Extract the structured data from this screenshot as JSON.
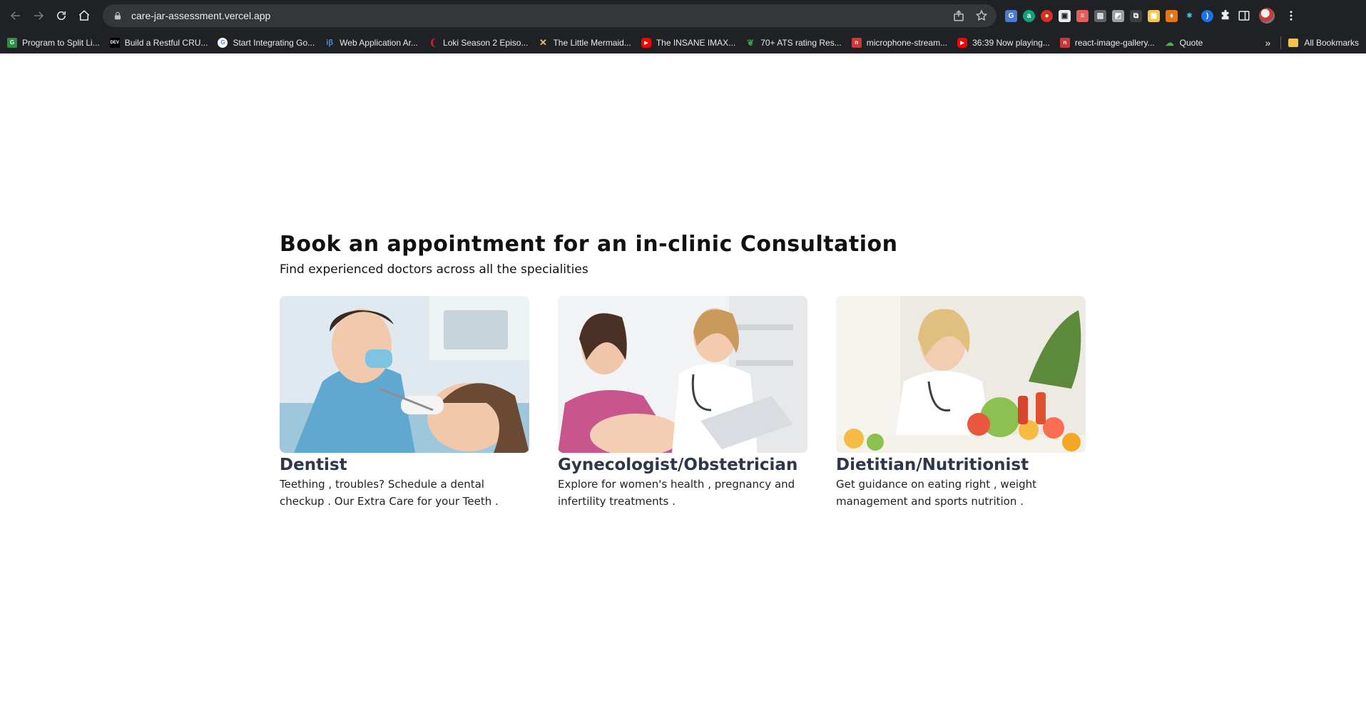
{
  "browser": {
    "url": "care-jar-assessment.vercel.app",
    "bookmarks": [
      {
        "label": "Program to Split Li...",
        "icon": "gfg-icon",
        "color": "#2f8d46"
      },
      {
        "label": "Build a Restful CRU...",
        "icon": "dev-icon",
        "color": "#000000"
      },
      {
        "label": "Start Integrating Go...",
        "icon": "google-icon",
        "color": "#ffffff"
      },
      {
        "label": "Web Application Ar...",
        "icon": "beta-icon",
        "color": "#4a90d9"
      },
      {
        "label": "Loki Season 2 Episo...",
        "icon": "loki-icon",
        "color": "#c62828"
      },
      {
        "label": "The Little Mermaid...",
        "icon": "x-star-icon",
        "color": "#e8c07a"
      },
      {
        "label": "The INSANE IMAX...",
        "icon": "youtube-icon",
        "color": "#ff0000"
      },
      {
        "label": "70+ ATS rating Res...",
        "icon": "leaf-icon",
        "color": "#3fa34d"
      },
      {
        "label": "microphone-stream...",
        "icon": "npm-icon",
        "color": "#cb3837"
      },
      {
        "label": "36:39 Now playing...",
        "icon": "youtube-icon",
        "color": "#ff0000"
      },
      {
        "label": "react-image-gallery...",
        "icon": "npm-icon",
        "color": "#cb3837"
      },
      {
        "label": "Quote",
        "icon": "cloud-icon",
        "color": "#4caf50"
      }
    ],
    "overflow": "»",
    "all_bookmarks": "All Bookmarks"
  },
  "page": {
    "heading": "Book an appointment for an in-clinic Consultation",
    "subheading": "Find experienced doctors across all the specialities",
    "cards": [
      {
        "title": "Dentist",
        "description": "Teething , troubles? Schedule a dental checkup . Our Extra Care for your Teeth ."
      },
      {
        "title": "Gynecologist/Obstetrician",
        "description": "Explore for women's health , pregnancy and infertility treatments ."
      },
      {
        "title": "Dietitian/Nutritionist",
        "description": "Get guidance on eating right , weight management and sports nutrition ."
      }
    ]
  }
}
